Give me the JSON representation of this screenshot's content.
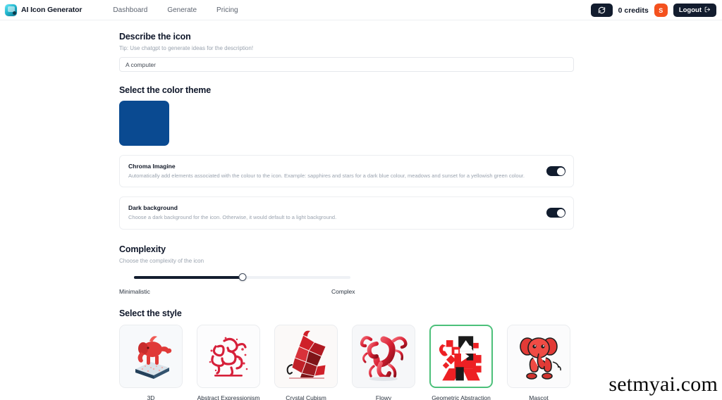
{
  "navbar": {
    "logo_icon": "app-logo-icon",
    "brand": "AI Icon Generator",
    "links": [
      {
        "label": "Dashboard"
      },
      {
        "label": "Generate"
      },
      {
        "label": "Pricing"
      }
    ],
    "refresh_icon": "refresh-icon",
    "credits": "0 credits",
    "avatar_initial": "S",
    "logout_label": "Logout",
    "logout_icon": "logout-arrow-icon"
  },
  "describe": {
    "title": "Describe the icon",
    "tip": "Tip: Use chatgpt to generate ideas for the description!",
    "input_value": "A computer",
    "input_placeholder": "A computer"
  },
  "color_theme": {
    "title": "Select the color theme",
    "selected_color": "#0a4a91"
  },
  "chroma": {
    "title": "Chroma Imagine",
    "description": "Automatically add elements associated with the colour to the icon. Example: sapphires and stars for a dark blue colour, meadows and sunset for a yellowish green colour.",
    "enabled": "on"
  },
  "dark_background": {
    "title": "Dark background",
    "description": "Choose a dark background for the icon. Otherwise, it would default to a light background.",
    "enabled": "on"
  },
  "complexity": {
    "title": "Complexity",
    "subtitle": "Choose the complexity of the icon",
    "min_label": "Minimalistic",
    "max_label": "Complex",
    "value_percent": 50
  },
  "styles": {
    "title": "Select the style",
    "selected": "Geometric Abstraction",
    "items": [
      {
        "label": "3D",
        "preview": "3d-elephant-preview"
      },
      {
        "label": "Abstract Expressionism",
        "preview": "abstract-elephant-preview"
      },
      {
        "label": "Crystal Cubism",
        "preview": "cubism-elephant-preview"
      },
      {
        "label": "Flowy",
        "preview": "flowy-elephant-preview"
      },
      {
        "label": "Geometric Abstraction",
        "preview": "geometric-elephant-preview"
      },
      {
        "label": "Mascot",
        "preview": "mascot-elephant-preview"
      }
    ]
  },
  "watermark": {
    "text": "setmyai.com"
  },
  "colors": {
    "accent_dark": "#121c2e",
    "selected_border": "#4cc07a",
    "avatar_bg": "#f4511e",
    "art_red": "#e8222c"
  }
}
